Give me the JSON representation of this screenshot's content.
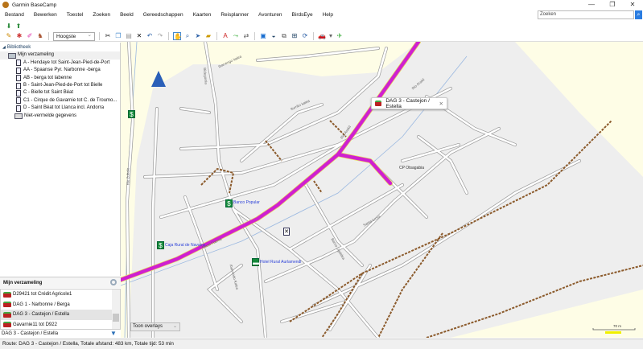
{
  "window": {
    "title": "Garmin BaseCamp",
    "controls": [
      "—",
      "❐",
      "✕"
    ]
  },
  "menu": [
    "Bestand",
    "Bewerken",
    "Toestel",
    "Zoeken",
    "Beeld",
    "Gereedschappen",
    "Kaarten",
    "Reisplanner",
    "Avonturen",
    "BirdsEye",
    "Help"
  ],
  "search": {
    "placeholder": "Zoeken"
  },
  "toolbar": {
    "detail_level": "Hoogste"
  },
  "library": {
    "root": "Bibliotheek",
    "collection": "Mijn verzameling",
    "items": [
      "A - Hendaye tot Saint-Jean-Pied-de-Port",
      "AA - Spaanse Pyr. Narbonne -berga",
      "AB - berga tot labenne",
      "B - Saint-Jean-Pied-de-Port tot Bielle",
      "C - Bielle tot Saint Béat",
      "C1 - Cirque de Gavarnie tot C. de Troumo...",
      "D - Saint Béat tot Llanca incl. Andorra"
    ],
    "unlisted": "Niet-vermelde gegevens"
  },
  "collection_panel": {
    "title": "Mijn verzameling",
    "routes": [
      "D29421 tot Crédit Agricole1",
      "DAG 1 - Narbonne / Berga",
      "DAG 3 - Castejon / Estella",
      "Gavarnie11 tot D922"
    ],
    "selected_index": 2,
    "selected": "DAG 3 - Castejon / Estella"
  },
  "map": {
    "overlay_select": "Toon overlays",
    "popup": "DAG 3 - Castejon / Estella",
    "pois": [
      "Banco Popular",
      "Caja Rural de Navarra",
      "Hotel Rural Aurlamendi",
      "CP Otsagabia"
    ],
    "streets": [
      "Rio Arakil",
      "Rio Zubalo",
      "Rio Arakil",
      "Ibarrengo kalea",
      "Bidegorria",
      "Iturriko kalea",
      "Plaza Fueros",
      "Ibarrondo Kalea",
      "Santa Luzia",
      "Barrio Ugaldea"
    ],
    "scale": "70 m",
    "colors": {
      "route": "#d020d0",
      "trail": "#8b5a2b",
      "land": "#fefde6",
      "urban": "#eeeeee"
    }
  },
  "status": "Route: DAG 3 - Castejon / Estella, Totale afstand: 483 km, Totale tijd: 53 min"
}
